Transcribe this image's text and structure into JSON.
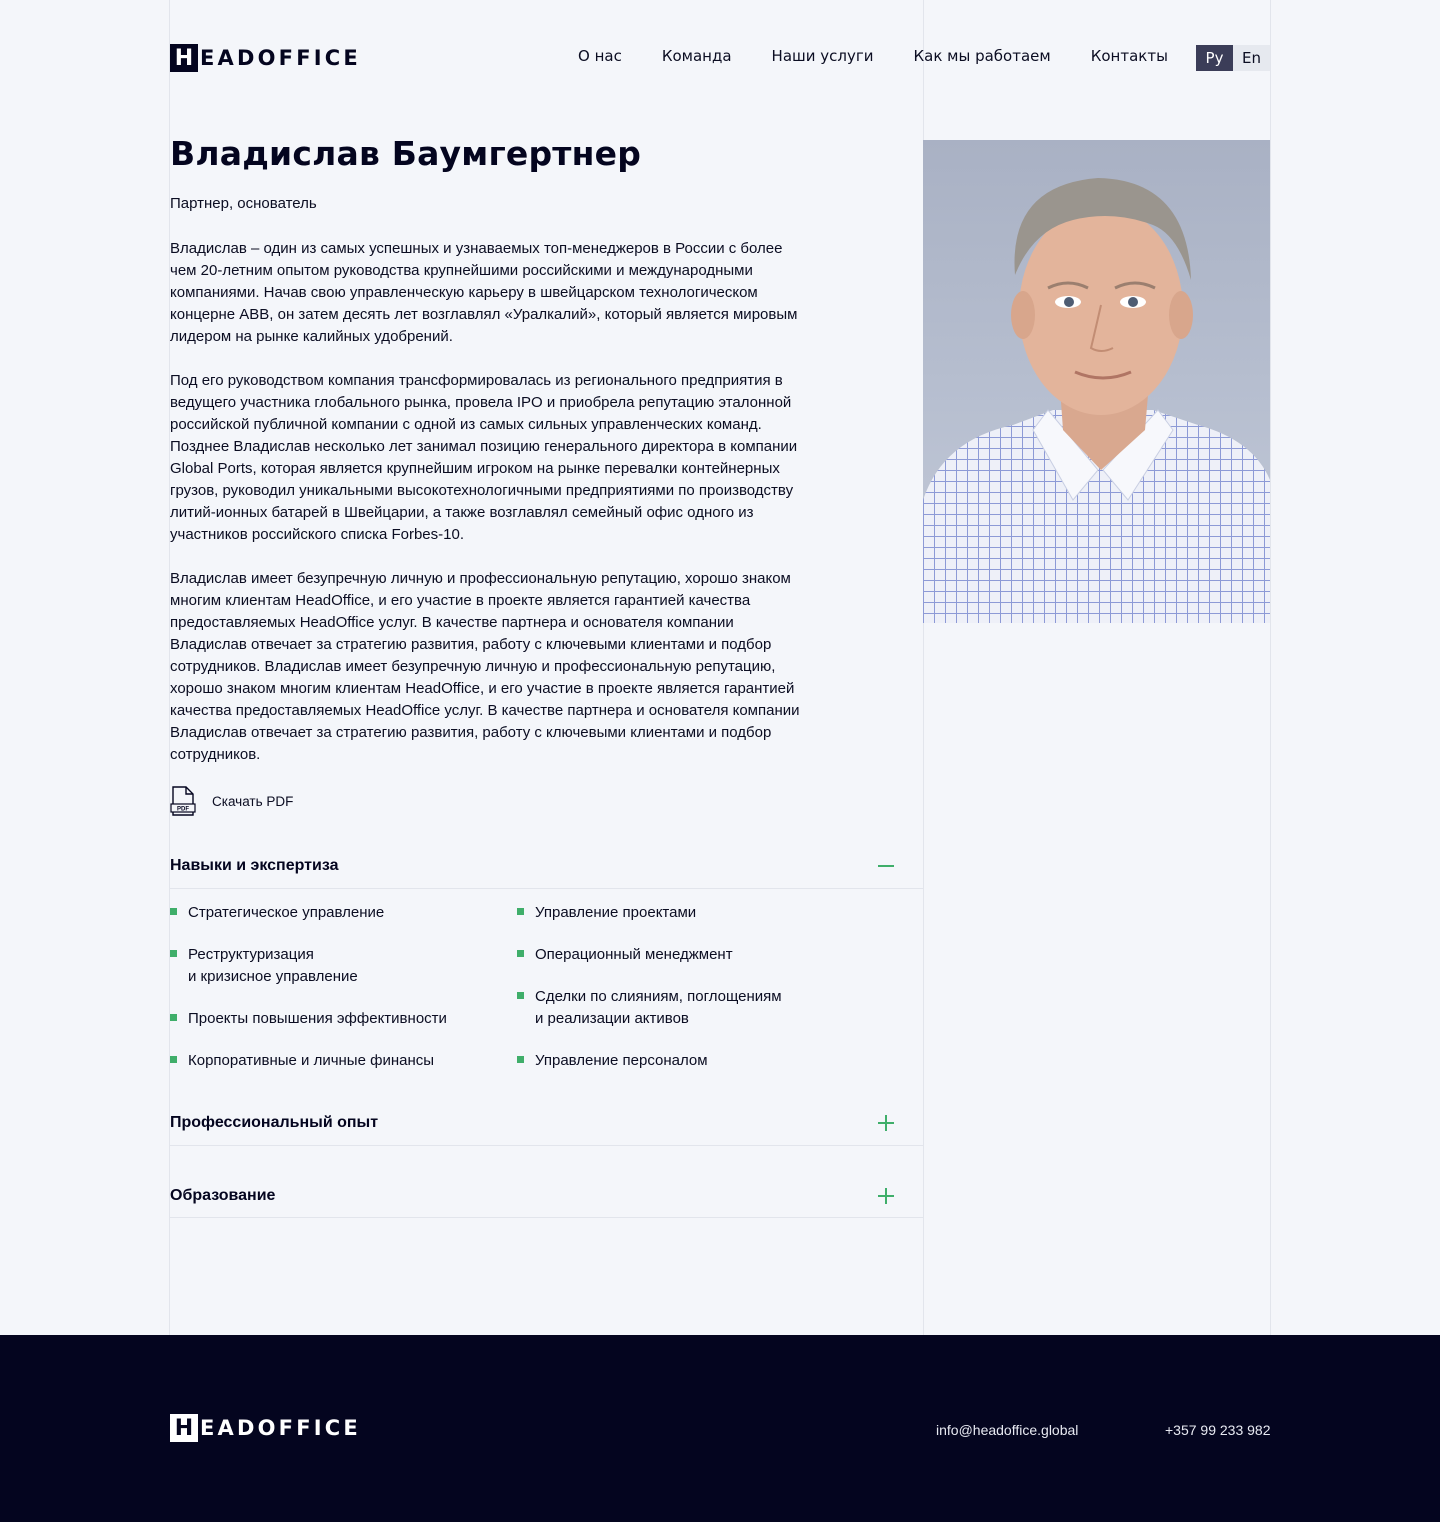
{
  "brand": {
    "logo_letter": "H",
    "logo_word": "EADOFFICE"
  },
  "nav": {
    "items": [
      "О нас",
      "Команда",
      "Наши услуги",
      "Как мы работаем",
      "Контакты"
    ],
    "lang_active": "Ру",
    "lang_inactive": "En"
  },
  "profile": {
    "name": "Владислав Баумгертнер",
    "role": "Партнер, основатель",
    "bio": [
      "Владислав – один из самых успешных и узнаваемых топ-менеджеров в России с более чем 20-летним опытом руководства крупнейшими российскими и международными компаниями. Начав свою управленческую карьеру в швейцарском технологическом концерне ABB, он затем десять лет возглавлял «Уралкалий», который является мировым лидером на рынке калийных удобрений.",
      "Под его руководством компания трансформировалась из регионального предприятия в ведущего участника глобального рынка, провела IPO и приобрела репутацию эталонной российской публичной компании с одной из самых сильных управленческих команд. Позднее Владислав несколько лет занимал позицию генерального директора в компании Global Ports, которая является крупнейшим игроком на рынке перевалки контейнерных грузов, руководил уникальными высокотехнологичными предприятиями по производству литий-ионных батарей в Швейцарии, а также возглавлял семейный офис одного из участников российского списка Forbes-10.",
      "Владислав имеет безупречную личную и профессиональную репутацию, хорошо знаком многим клиентам HeadOffice, и его участие в проекте является гарантией качества предоставляемых HeadOffice услуг. В качестве партнера и основателя компании Владислав отвечает за стратегию развития, работу с ключевыми клиентами и подбор сотрудников. Владислав имеет безупречную личную и профессиональную репутацию, хорошо знаком многим клиентам HeadOffice, и его участие в проекте является гарантией качества предоставляемых HeadOffice услуг. В качестве партнера и основателя компании Владислав отвечает за стратегию развития, работу с ключевыми клиентами и подбор сотрудников."
    ],
    "pdf_icon_text": "PDF",
    "pdf_label": "Скачать PDF"
  },
  "accordion": {
    "skills_title": "Навыки и экспертиза",
    "skills_left": [
      "Стратегическое управление",
      "Реструктуризация\nи кризисное управление",
      "Проекты повышения эффективности",
      "Корпоративные и личные финансы"
    ],
    "skills_right": [
      "Управление проектами",
      "Операционный менеджмент",
      "Сделки по слияниям, поглощениям\nи реализации активов",
      "Управление персоналом"
    ],
    "experience_title": "Профессиональный опыт",
    "education_title": "Образование"
  },
  "footer": {
    "email": "info@headoffice.global",
    "phone": "+357 99 233 982"
  },
  "colors": {
    "navy": "#04051f",
    "accent_green": "#3fae6a",
    "background": "#f4f6fa"
  },
  "icons": [
    "pdf-file-icon",
    "minus-icon",
    "plus-icon"
  ]
}
